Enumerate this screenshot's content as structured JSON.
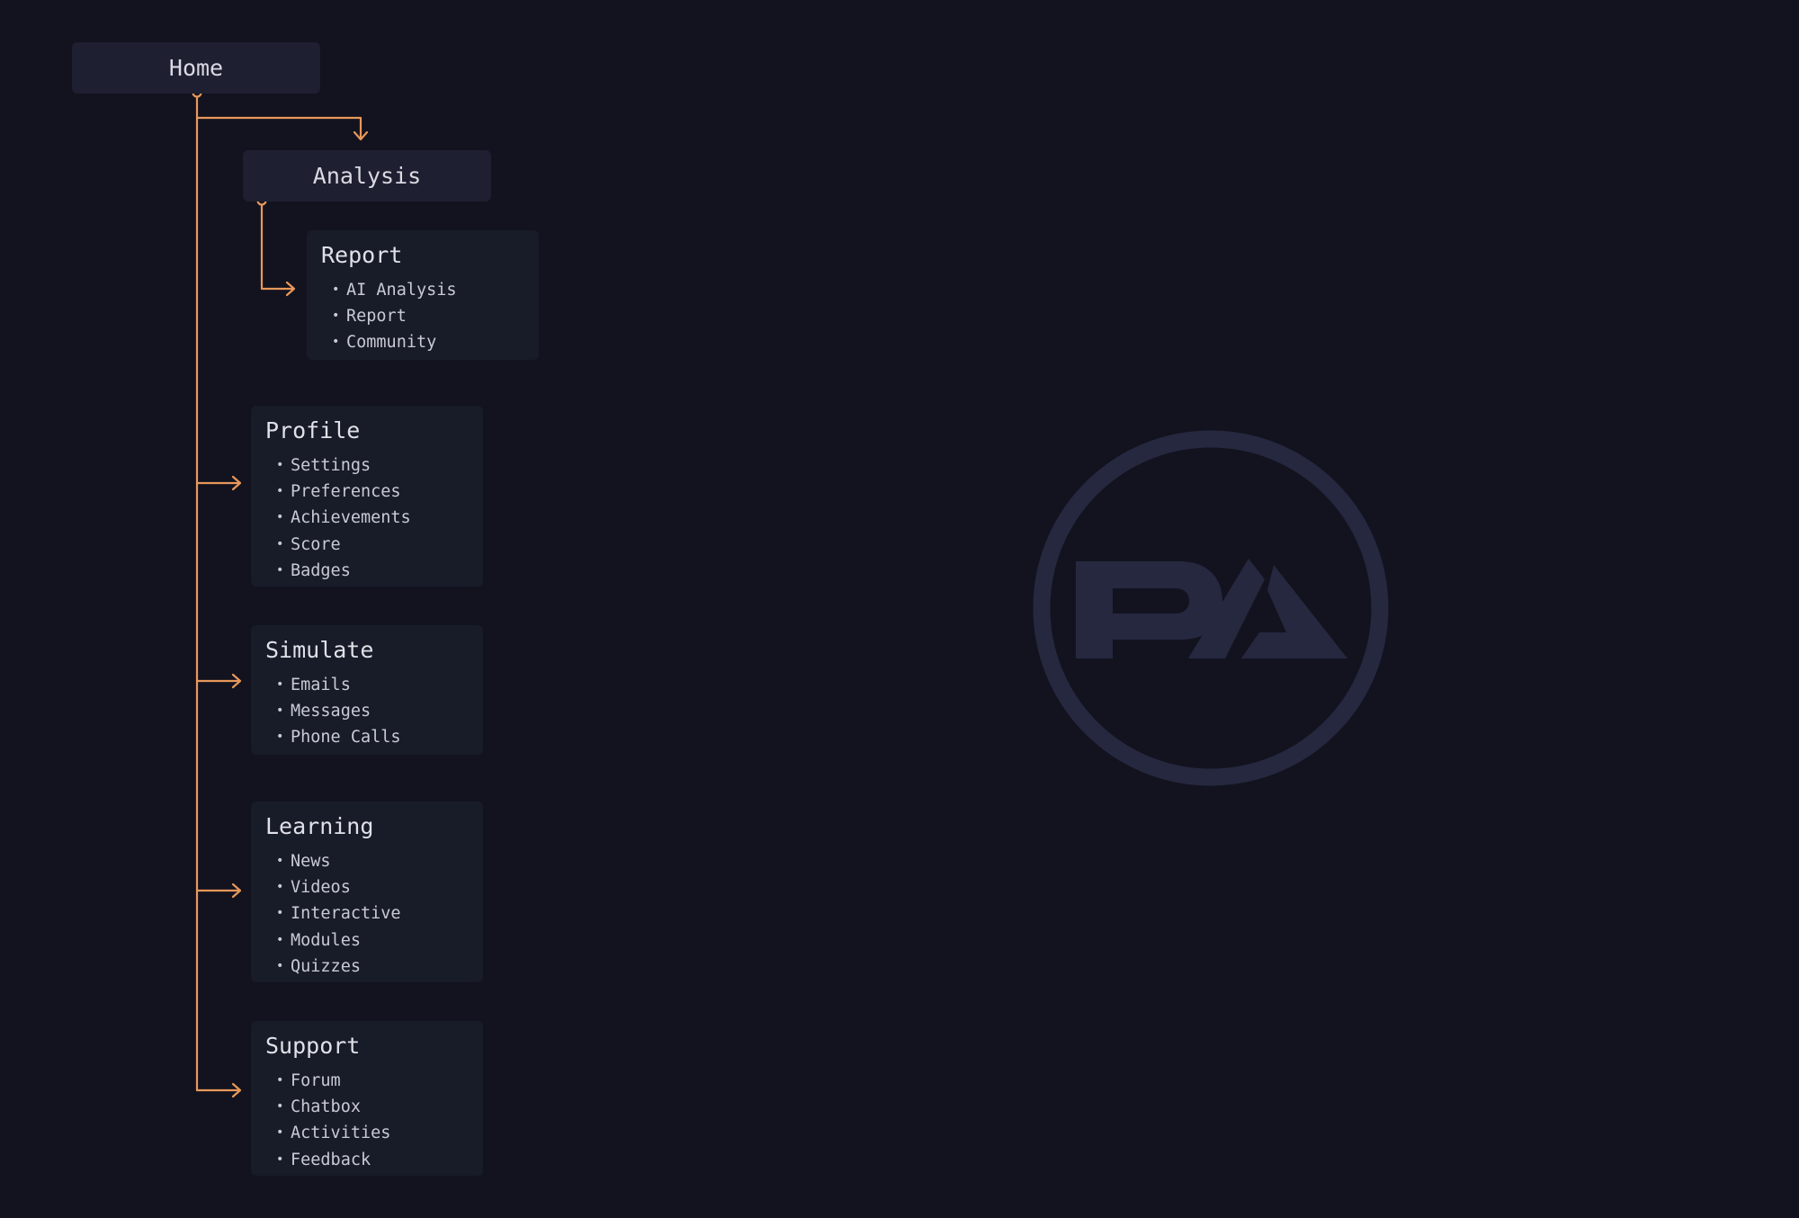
{
  "colors": {
    "background": "#13131f",
    "connector": "#e8985a",
    "node_fill": "#1e1f31",
    "card_fill": "#181b28",
    "logo": "#25283f"
  },
  "root": {
    "label": "Home"
  },
  "analysis": {
    "label": "Analysis",
    "children": [
      {
        "title": "Report",
        "items": [
          "AI Analysis",
          "Report",
          "Community"
        ]
      }
    ]
  },
  "sections": [
    {
      "title": "Profile",
      "items": [
        "Settings",
        "Preferences",
        "Achievements",
        "Score",
        "Badges"
      ]
    },
    {
      "title": "Simulate",
      "items": [
        "Emails",
        "Messages",
        "Phone Calls"
      ]
    },
    {
      "title": "Learning",
      "items": [
        "News",
        "Videos",
        "Interactive",
        "Modules",
        "Quizzes"
      ]
    },
    {
      "title": "Support",
      "items": [
        "Forum",
        "Chatbox",
        "Activities",
        "Feedback"
      ]
    }
  ],
  "logo": {
    "text": "PA",
    "icon": "pa-monogram-circle-icon"
  }
}
